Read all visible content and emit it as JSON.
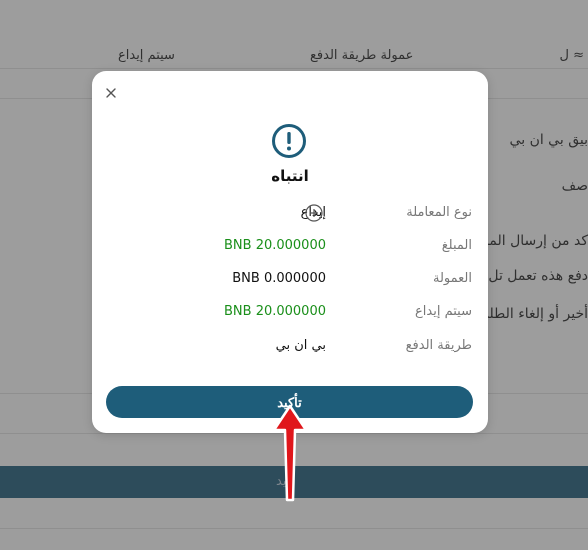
{
  "background": {
    "header_col1": "≈ ل",
    "header_col2": "عمولة طريقة الدفع",
    "header_col3": "سيتم إيداع",
    "line1": "بيق بي ان بي",
    "line2": "صف",
    "line3": "كد من إرسال المبلغ",
    "line4": "دفع هذه تعمل تل",
    "line5": "أخير أو إلغاء الطلب",
    "bar_text": "إيد"
  },
  "modal": {
    "title": "انتباه",
    "rows": [
      {
        "label": "نوع المعاملة",
        "value": "إيداع"
      },
      {
        "label": "المبلغ",
        "value": "BNB 20.000000"
      },
      {
        "label": "العمولة",
        "value": "BNB 0.000000"
      },
      {
        "label": "سيتم إيداع",
        "value": "BNB 20.000000"
      },
      {
        "label": "طريقة الدفع",
        "value": "بي ان بي"
      }
    ],
    "confirm_label": "تأكيد"
  },
  "colors": {
    "primary": "#1e5d7a",
    "green": "#1a8f1a",
    "arrow": "#e0161b"
  }
}
